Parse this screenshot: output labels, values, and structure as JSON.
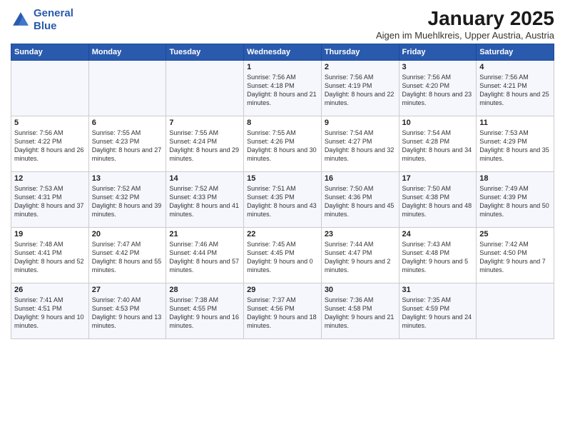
{
  "logo": {
    "line1": "General",
    "line2": "Blue"
  },
  "title": "January 2025",
  "subtitle": "Aigen im Muehlkreis, Upper Austria, Austria",
  "weekdays": [
    "Sunday",
    "Monday",
    "Tuesday",
    "Wednesday",
    "Thursday",
    "Friday",
    "Saturday"
  ],
  "weeks": [
    [
      {
        "day": "",
        "info": ""
      },
      {
        "day": "",
        "info": ""
      },
      {
        "day": "",
        "info": ""
      },
      {
        "day": "1",
        "info": "Sunrise: 7:56 AM\nSunset: 4:18 PM\nDaylight: 8 hours and 21 minutes."
      },
      {
        "day": "2",
        "info": "Sunrise: 7:56 AM\nSunset: 4:19 PM\nDaylight: 8 hours and 22 minutes."
      },
      {
        "day": "3",
        "info": "Sunrise: 7:56 AM\nSunset: 4:20 PM\nDaylight: 8 hours and 23 minutes."
      },
      {
        "day": "4",
        "info": "Sunrise: 7:56 AM\nSunset: 4:21 PM\nDaylight: 8 hours and 25 minutes."
      }
    ],
    [
      {
        "day": "5",
        "info": "Sunrise: 7:56 AM\nSunset: 4:22 PM\nDaylight: 8 hours and 26 minutes."
      },
      {
        "day": "6",
        "info": "Sunrise: 7:55 AM\nSunset: 4:23 PM\nDaylight: 8 hours and 27 minutes."
      },
      {
        "day": "7",
        "info": "Sunrise: 7:55 AM\nSunset: 4:24 PM\nDaylight: 8 hours and 29 minutes."
      },
      {
        "day": "8",
        "info": "Sunrise: 7:55 AM\nSunset: 4:26 PM\nDaylight: 8 hours and 30 minutes."
      },
      {
        "day": "9",
        "info": "Sunrise: 7:54 AM\nSunset: 4:27 PM\nDaylight: 8 hours and 32 minutes."
      },
      {
        "day": "10",
        "info": "Sunrise: 7:54 AM\nSunset: 4:28 PM\nDaylight: 8 hours and 34 minutes."
      },
      {
        "day": "11",
        "info": "Sunrise: 7:53 AM\nSunset: 4:29 PM\nDaylight: 8 hours and 35 minutes."
      }
    ],
    [
      {
        "day": "12",
        "info": "Sunrise: 7:53 AM\nSunset: 4:31 PM\nDaylight: 8 hours and 37 minutes."
      },
      {
        "day": "13",
        "info": "Sunrise: 7:52 AM\nSunset: 4:32 PM\nDaylight: 8 hours and 39 minutes."
      },
      {
        "day": "14",
        "info": "Sunrise: 7:52 AM\nSunset: 4:33 PM\nDaylight: 8 hours and 41 minutes."
      },
      {
        "day": "15",
        "info": "Sunrise: 7:51 AM\nSunset: 4:35 PM\nDaylight: 8 hours and 43 minutes."
      },
      {
        "day": "16",
        "info": "Sunrise: 7:50 AM\nSunset: 4:36 PM\nDaylight: 8 hours and 45 minutes."
      },
      {
        "day": "17",
        "info": "Sunrise: 7:50 AM\nSunset: 4:38 PM\nDaylight: 8 hours and 48 minutes."
      },
      {
        "day": "18",
        "info": "Sunrise: 7:49 AM\nSunset: 4:39 PM\nDaylight: 8 hours and 50 minutes."
      }
    ],
    [
      {
        "day": "19",
        "info": "Sunrise: 7:48 AM\nSunset: 4:41 PM\nDaylight: 8 hours and 52 minutes."
      },
      {
        "day": "20",
        "info": "Sunrise: 7:47 AM\nSunset: 4:42 PM\nDaylight: 8 hours and 55 minutes."
      },
      {
        "day": "21",
        "info": "Sunrise: 7:46 AM\nSunset: 4:44 PM\nDaylight: 8 hours and 57 minutes."
      },
      {
        "day": "22",
        "info": "Sunrise: 7:45 AM\nSunset: 4:45 PM\nDaylight: 9 hours and 0 minutes."
      },
      {
        "day": "23",
        "info": "Sunrise: 7:44 AM\nSunset: 4:47 PM\nDaylight: 9 hours and 2 minutes."
      },
      {
        "day": "24",
        "info": "Sunrise: 7:43 AM\nSunset: 4:48 PM\nDaylight: 9 hours and 5 minutes."
      },
      {
        "day": "25",
        "info": "Sunrise: 7:42 AM\nSunset: 4:50 PM\nDaylight: 9 hours and 7 minutes."
      }
    ],
    [
      {
        "day": "26",
        "info": "Sunrise: 7:41 AM\nSunset: 4:51 PM\nDaylight: 9 hours and 10 minutes."
      },
      {
        "day": "27",
        "info": "Sunrise: 7:40 AM\nSunset: 4:53 PM\nDaylight: 9 hours and 13 minutes."
      },
      {
        "day": "28",
        "info": "Sunrise: 7:38 AM\nSunset: 4:55 PM\nDaylight: 9 hours and 16 minutes."
      },
      {
        "day": "29",
        "info": "Sunrise: 7:37 AM\nSunset: 4:56 PM\nDaylight: 9 hours and 18 minutes."
      },
      {
        "day": "30",
        "info": "Sunrise: 7:36 AM\nSunset: 4:58 PM\nDaylight: 9 hours and 21 minutes."
      },
      {
        "day": "31",
        "info": "Sunrise: 7:35 AM\nSunset: 4:59 PM\nDaylight: 9 hours and 24 minutes."
      },
      {
        "day": "",
        "info": ""
      }
    ]
  ]
}
